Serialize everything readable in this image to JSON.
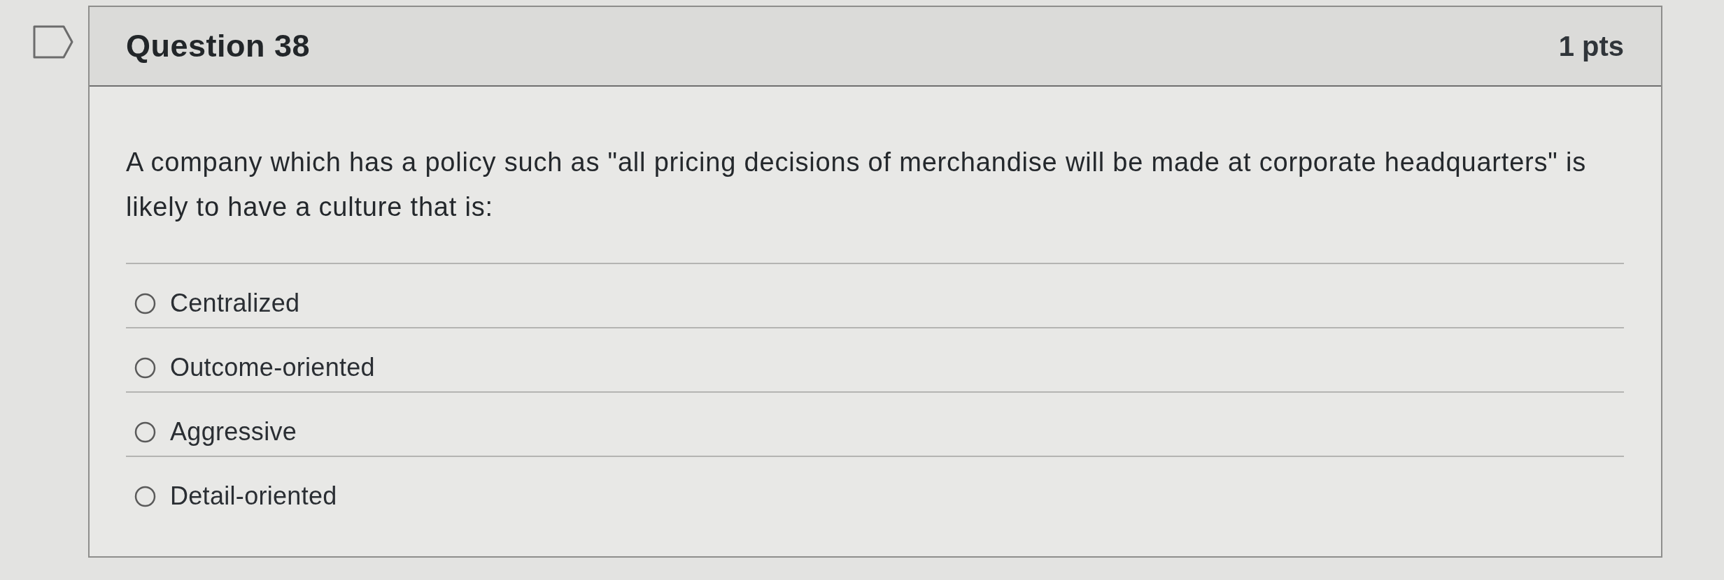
{
  "question": {
    "title": "Question 38",
    "points": "1 pts",
    "text": "A company which has a policy such as \"all pricing decisions of merchandise will be made at corporate headquarters\" is likely to have a culture that is:",
    "answers": [
      {
        "label": "Centralized",
        "selected": false
      },
      {
        "label": "Outcome-oriented",
        "selected": false
      },
      {
        "label": "Aggressive",
        "selected": false
      },
      {
        "label": "Detail-oriented",
        "selected": false
      }
    ]
  }
}
